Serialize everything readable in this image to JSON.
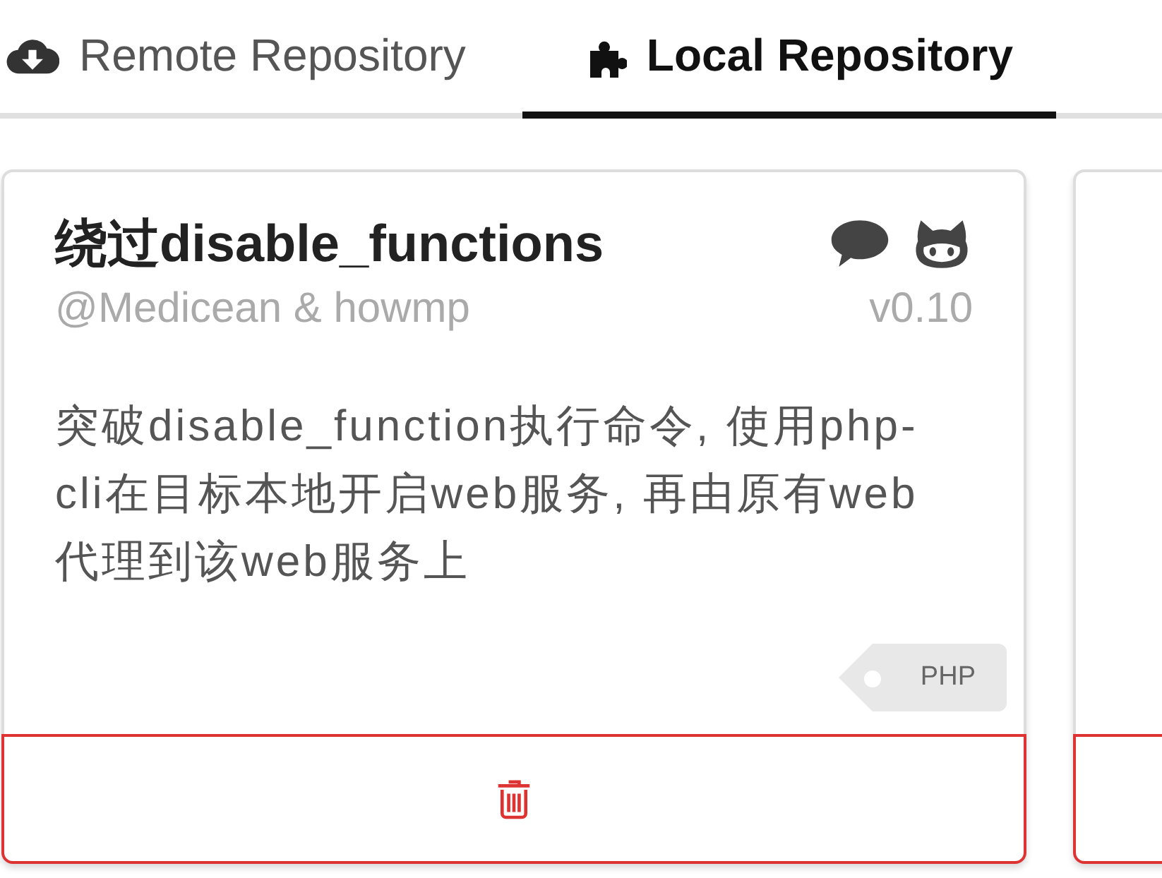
{
  "tabs": [
    {
      "label": "Remote Repository",
      "selected": false
    },
    {
      "label": "Local Repository",
      "selected": true
    }
  ],
  "cards": [
    {
      "title": "绕过disable_functions",
      "author": "@Medicean & howmp",
      "version": "v0.10",
      "description": "突破disable_function执行命令, 使用php-cli在目标本地开启web服务, 再由原有web代理到该web服务上",
      "tags": [
        "PHP"
      ],
      "icons": true
    },
    {
      "icons": false
    }
  ]
}
